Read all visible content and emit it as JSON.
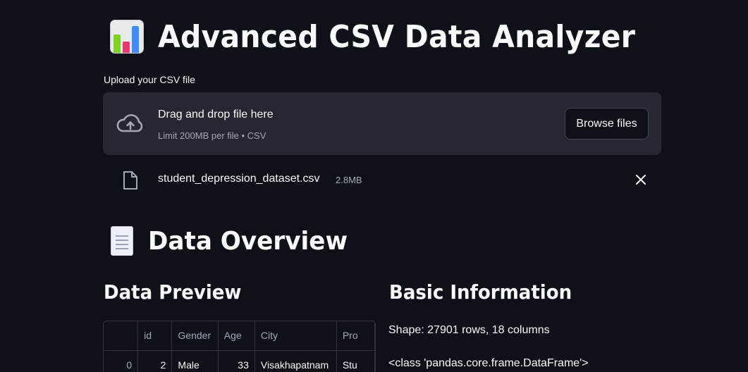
{
  "header": {
    "title": "Advanced CSV Data Analyzer",
    "icon": "bar-chart-icon"
  },
  "uploader": {
    "label": "Upload your CSV file",
    "drop_text": "Drag and drop file here",
    "limit_text": "Limit 200MB per file • CSV",
    "browse_label": "Browse files",
    "icon": "cloud-upload-icon"
  },
  "uploaded_file": {
    "name": "student_depression_dataset.csv",
    "size": "2.8MB",
    "icon": "file-icon",
    "remove_icon": "close-icon"
  },
  "overview": {
    "title": "Data Overview",
    "icon": "page-document-icon"
  },
  "preview": {
    "title": "Data Preview",
    "columns": [
      "",
      "id",
      "Gender",
      "Age",
      "City",
      "Pro"
    ],
    "rows": [
      [
        "0",
        "2",
        "Male",
        "33",
        "Visakhapatnam",
        "Stu"
      ]
    ]
  },
  "basic_info": {
    "title": "Basic Information",
    "shape": "Shape: 27901 rows, 18 columns",
    "class_line": "<class 'pandas.core.frame.DataFrame'>"
  },
  "colors": {
    "background": "#0e1117",
    "panel": "#262730",
    "text": "#fafafa",
    "muted": "#a3a8b4",
    "border": "#31333f"
  }
}
